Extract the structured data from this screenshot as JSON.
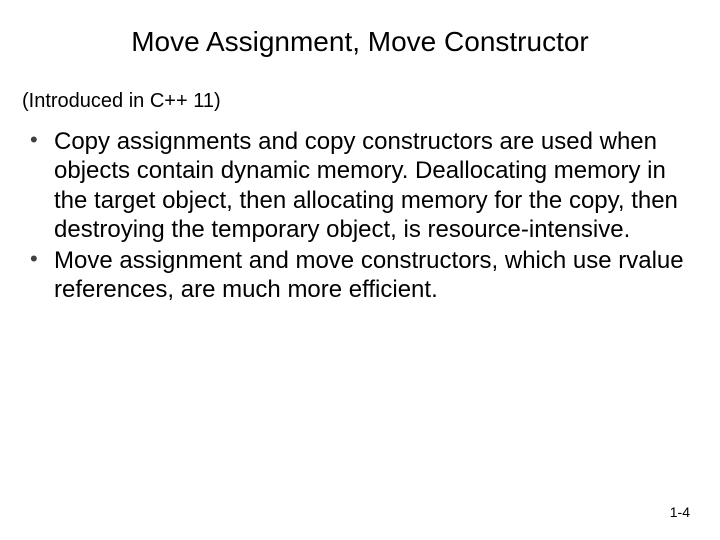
{
  "title": "Move Assignment, Move Constructor",
  "subtitle": "(Introduced in C++ 11)",
  "bullets": [
    "Copy assignments and copy constructors are used when objects contain dynamic memory. Deallocating memory in the target object, then allocating memory for the copy, then destroying the temporary object, is resource-intensive.",
    "Move assignment and move constructors, which use rvalue references, are much more efficient."
  ],
  "page_number": "1-4"
}
